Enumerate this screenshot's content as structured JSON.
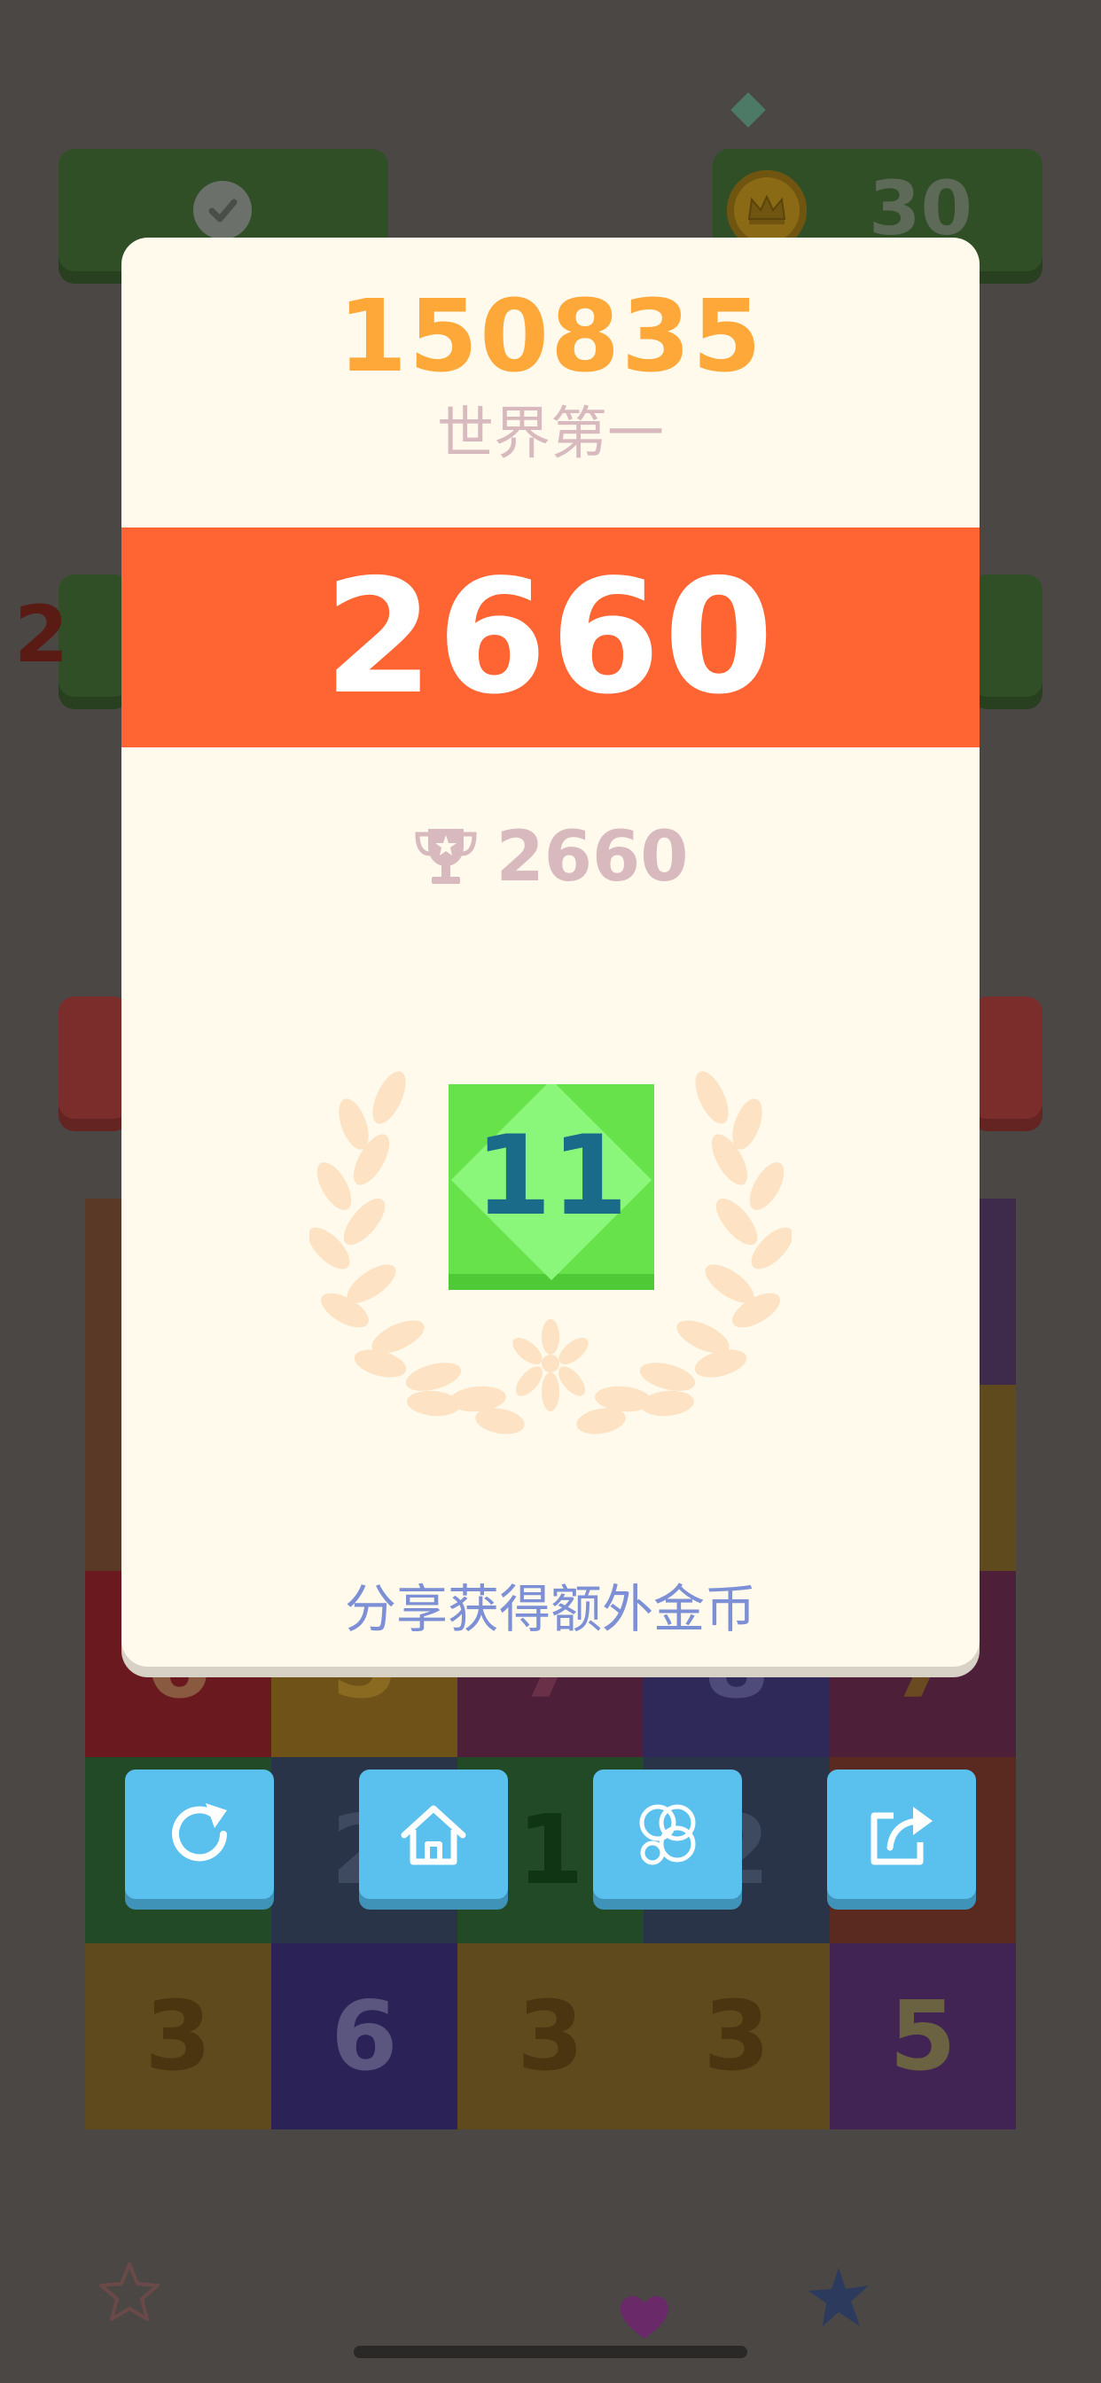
{
  "background": {
    "coin_count": "30",
    "side_number": "2",
    "grid": [
      [
        {
          "v": "",
          "bg": "#5a3a26",
          "c": "#6a4a30"
        },
        {
          "v": "",
          "bg": "#5a3a26",
          "c": "#6a4a30"
        },
        {
          "v": "",
          "bg": "#5a3a26",
          "c": "#6a4a30"
        },
        {
          "v": "",
          "bg": "#5a3a26",
          "c": "#6a4a30"
        },
        {
          "v": "",
          "bg": "#3e2a4a",
          "c": "#4e3a5a"
        }
      ],
      [
        {
          "v": "",
          "bg": "#5a3a26",
          "c": "#6a4a30"
        },
        {
          "v": "",
          "bg": "#5a3a26",
          "c": "#6a4a30"
        },
        {
          "v": "",
          "bg": "#5a3a26",
          "c": "#6a4a30"
        },
        {
          "v": "",
          "bg": "#5a3a26",
          "c": "#6a4a30"
        },
        {
          "v": "",
          "bg": "#5e4a1c",
          "c": "#6e5a2c"
        }
      ],
      [
        {
          "v": "6",
          "bg": "#6a1a1e",
          "c": "#8a5a40"
        },
        {
          "v": "5",
          "bg": "#6e5218",
          "c": "#8a6a20"
        },
        {
          "v": "7",
          "bg": "#4e1f38",
          "c": "#6a3048"
        },
        {
          "v": "8",
          "bg": "#2e2958",
          "c": "#4e4a7a"
        },
        {
          "v": "7",
          "bg": "#4e1f38",
          "c": "#6a4a20"
        }
      ],
      [
        {
          "v": "",
          "bg": "#234a26",
          "c": "#2a5a2e"
        },
        {
          "v": "2",
          "bg": "#2a3448",
          "c": "#3e4a60"
        },
        {
          "v": "1",
          "bg": "#234a26",
          "c": "#0f3514"
        },
        {
          "v": "2",
          "bg": "#2a3448",
          "c": "#3e4a60"
        },
        {
          "v": "",
          "bg": "#5a2a20",
          "c": "#6a3a2a"
        }
      ],
      [
        {
          "v": "3",
          "bg": "#5e4a1c",
          "c": "#4a3510"
        },
        {
          "v": "6",
          "bg": "#2b2358",
          "c": "#5a5680"
        },
        {
          "v": "3",
          "bg": "#5e4a1c",
          "c": "#4a3510"
        },
        {
          "v": "3",
          "bg": "#5e4a1c",
          "c": "#4a3510"
        },
        {
          "v": "5",
          "bg": "#422454",
          "c": "#6a6240"
        }
      ]
    ]
  },
  "result": {
    "best_score": "150835",
    "rank_label": "世界第一",
    "current_score": "2660",
    "trophy_score": "2660",
    "level": "11",
    "share_text": "分享获得额外金币"
  },
  "buttons": {
    "restart_icon": "restart-icon",
    "home_icon": "home-icon",
    "themes_icon": "themes-icon",
    "share_icon": "share-icon"
  },
  "colors": {
    "accent_orange": "#ff6433",
    "best_score": "#ffa83a",
    "button_blue": "#5ac0ee",
    "level_green": "#67e24a",
    "modal_bg": "#fffaec"
  }
}
